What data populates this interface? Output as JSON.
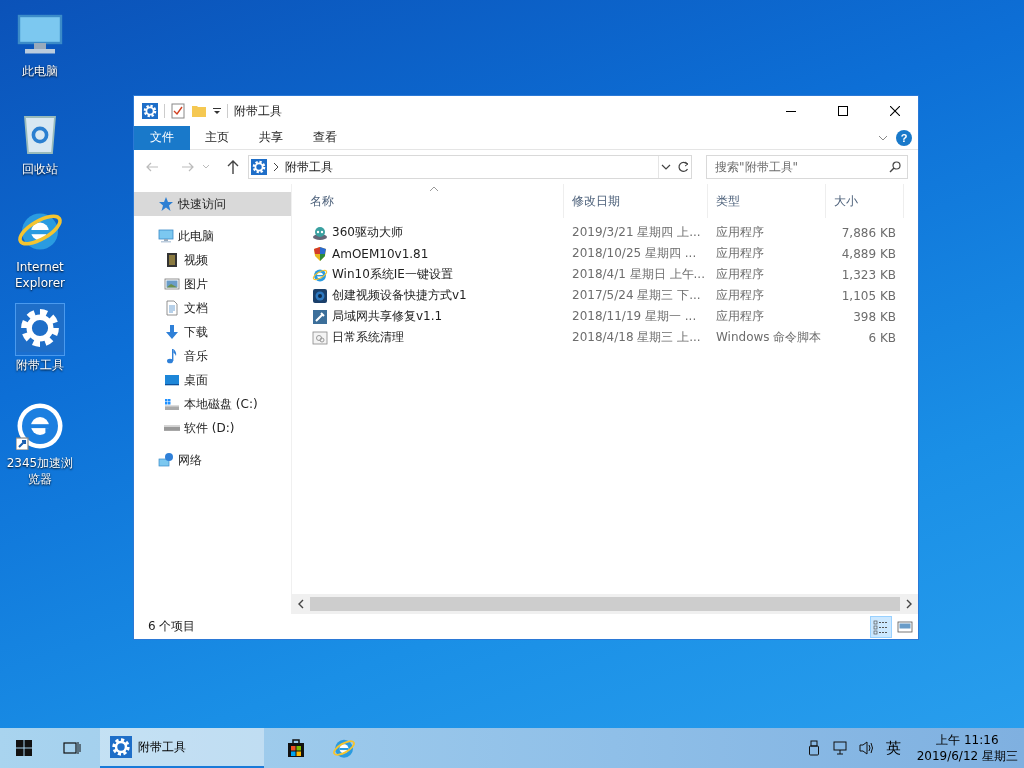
{
  "desktop_icons": [
    {
      "label": "此电脑",
      "kind": "computer",
      "selected": false
    },
    {
      "label": "回收站",
      "kind": "recycle",
      "selected": false
    },
    {
      "label": "Internet Explorer",
      "kind": "ie",
      "selected": false
    },
    {
      "label": "附带工具",
      "kind": "gear",
      "selected": true
    },
    {
      "label": "2345加速浏览器",
      "kind": "browser",
      "selected": false
    }
  ],
  "window": {
    "title": "附带工具",
    "ribbon_tabs": [
      {
        "label": "文件",
        "selected": true
      },
      {
        "label": "主页",
        "selected": false
      },
      {
        "label": "共享",
        "selected": false
      },
      {
        "label": "查看",
        "selected": false
      }
    ],
    "help_button": "?",
    "address": {
      "path": "附带工具"
    },
    "search": {
      "placeholder": "搜索\"附带工具\""
    },
    "navigation": [
      {
        "label": "快速访问",
        "kind": "star",
        "selected": true
      },
      {
        "label": "此电脑",
        "kind": "computer",
        "selected": false,
        "children": [
          {
            "label": "视频",
            "kind": "video",
            "selected": false
          },
          {
            "label": "图片",
            "kind": "picture",
            "selected": false
          },
          {
            "label": "文档",
            "kind": "document",
            "selected": false
          },
          {
            "label": "下载",
            "kind": "download",
            "selected": false
          },
          {
            "label": "音乐",
            "kind": "music",
            "selected": false
          },
          {
            "label": "桌面",
            "kind": "desktop",
            "selected": false
          },
          {
            "label": "本地磁盘 (C:)",
            "kind": "systemdrive",
            "selected": false
          },
          {
            "label": "软件 (D:)",
            "kind": "drive",
            "selected": false
          }
        ]
      },
      {
        "label": "网络",
        "kind": "network",
        "selected": false
      }
    ],
    "columns": [
      "名称",
      "修改日期",
      "类型",
      "大小"
    ],
    "rows": [
      {
        "name": "360驱动大师",
        "date": "2019/3/21 星期四 上...",
        "type": "应用程序",
        "size": "7,886 KB",
        "kind": "robot"
      },
      {
        "name": "AmOEM10v1.81",
        "date": "2018/10/25 星期四 ...",
        "type": "应用程序",
        "size": "4,889 KB",
        "kind": "shield"
      },
      {
        "name": "Win10系统IE一键设置",
        "date": "2018/4/1 星期日 上午...",
        "type": "应用程序",
        "size": "1,323 KB",
        "kind": "ie"
      },
      {
        "name": "创建视频设备快捷方式v1",
        "date": "2017/5/24 星期三 下...",
        "type": "应用程序",
        "size": "1,105 KB",
        "kind": "camera"
      },
      {
        "name": "局域网共享修复v1.1",
        "date": "2018/11/19 星期一 ...",
        "type": "应用程序",
        "size": "398 KB",
        "kind": "tool"
      },
      {
        "name": "日常系统清理",
        "date": "2018/4/18 星期三 上...",
        "type": "Windows 命令脚本",
        "size": "6 KB",
        "kind": "script"
      }
    ],
    "status": "6 个项目",
    "views": [
      {
        "kind": "details",
        "selected": true
      },
      {
        "kind": "largeicons",
        "selected": false
      }
    ]
  },
  "taskbar": {
    "window_button": {
      "label": "附带工具",
      "selected": true
    },
    "input_indicator": "英",
    "time": "上午 11:16",
    "date": "2019/6/12 星期三"
  }
}
